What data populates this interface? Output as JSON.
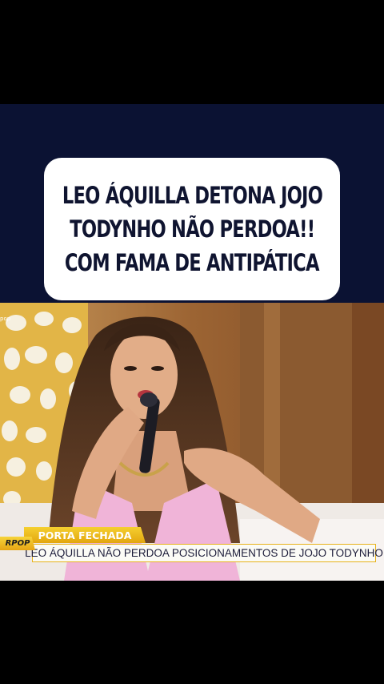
{
  "headline": {
    "lines": [
      "LEO ÁQUILLA DETONA JOJO",
      "TODYNHO NÃO PERDOA!!",
      "COM FAMA DE ANTIPÁTICA"
    ]
  },
  "video": {
    "corner_logo": "pop",
    "lower_third": {
      "tag": "PORTA FECHADA",
      "caption": "LEO ÁQUILLA NÃO PERDOA POSICIONAMENTOS DE JOJO TODYNHO",
      "channel": "RPOP"
    }
  },
  "colors": {
    "navy": "#0b1233",
    "tag_yellow": "#e3a60f",
    "dress_pink": "#f0b4d8"
  }
}
